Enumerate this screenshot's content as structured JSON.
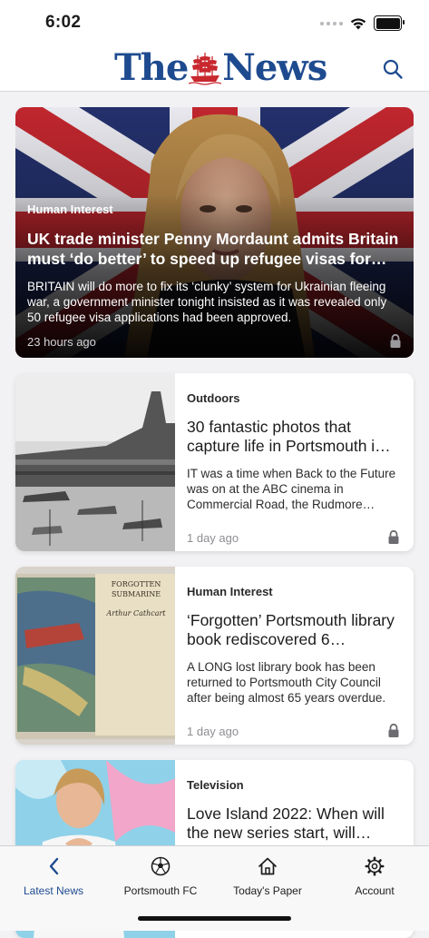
{
  "status_bar": {
    "time": "6:02"
  },
  "header": {
    "logo_left": "The",
    "logo_right": "News",
    "brand_color": "#1e4b8f",
    "search_icon": "search-icon"
  },
  "hero": {
    "category": "Human Interest",
    "title": "UK trade minister Penny Mordaunt admits Britain must ‘do better’ to speed up refugee visas for…",
    "description": "BRITAIN will do more to fix its ‘clunky’ system for Ukrainian fleeing war, a government minister tonight insisted as it was revealed only 50 refugee visa applications had been approved.",
    "time": "23 hours ago",
    "lock_icon": "lock-icon"
  },
  "articles": [
    {
      "category": "Outdoors",
      "title": "30 fantastic photos that capture life in Portsmouth i…",
      "description": "IT was a time when Back to the Future was on at the ABC cinema in Commercial Road, the Rudmore…",
      "time": "1 day ago"
    },
    {
      "category": "Human Interest",
      "title": "‘Forgotten’ Portsmouth library book rediscovered 6…",
      "description": "A LONG lost library book has been returned to Portsmouth City Council after being almost 65 years overdue.",
      "time": "1 day ago",
      "book_title": "FORGOTTEN SUBMARINE",
      "book_author": "Arthur Cathcart"
    },
    {
      "category": "Television",
      "title": "Love Island 2022: When will the new series start, will…",
      "description": "",
      "time": ""
    }
  ],
  "tabs": [
    {
      "label": "Latest News",
      "icon": "chevron-left-icon",
      "active": true
    },
    {
      "label": "Portsmouth FC",
      "icon": "football-icon",
      "active": false
    },
    {
      "label": "Today's Paper",
      "icon": "house-icon",
      "active": false
    },
    {
      "label": "Account",
      "icon": "gear-icon",
      "active": false
    }
  ]
}
